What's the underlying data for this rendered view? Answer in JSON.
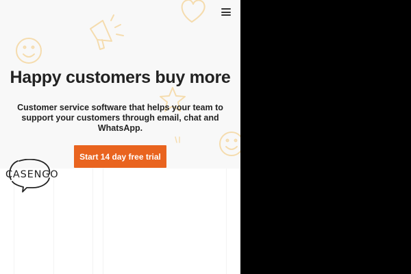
{
  "header": {
    "menu_icon": "hamburger-menu-icon"
  },
  "hero": {
    "headline": "Happy customers buy more",
    "subtitle": "Customer service software that helps your team to support your customers through email, chat and WhatsApp.",
    "cta_label": "Start 14 day free trial",
    "cta_color": "#e9641f",
    "background_color": "#f8f8f8",
    "doodle_color": "#f5dcae",
    "doodle_icons": [
      "smiley-icon",
      "heart-icon",
      "megaphone-icon",
      "star-icon",
      "smiley-icon"
    ]
  },
  "logo": {
    "text": "CASENGO",
    "icon": "speech-bubble-icon"
  }
}
